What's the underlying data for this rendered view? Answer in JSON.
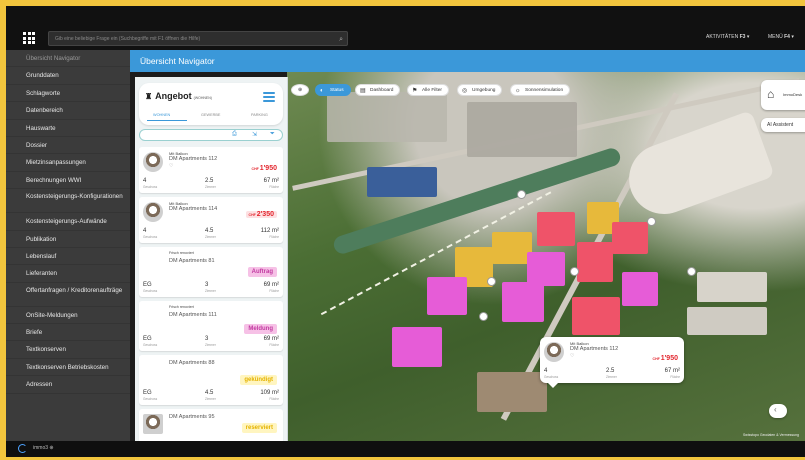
{
  "topbar": {
    "search_placeholder": "Gib eine beliebige Frage ein (Suchbegriffe mit F1 öffnen die Hilfe)",
    "activities_label": "AKTIVITÄTEN",
    "activities_count": "F3",
    "menu_label": "MENÜ",
    "menu_count": "F4"
  },
  "sidebar": {
    "items": [
      {
        "label": "Übersicht Navigator"
      },
      {
        "label": "Grunddaten"
      },
      {
        "label": "Schlagworte"
      },
      {
        "label": "Datenbereich"
      },
      {
        "label": "Hauswarte"
      },
      {
        "label": "Dossier"
      },
      {
        "label": "Mietzinsanpassungen"
      },
      {
        "label": "Berechnungen WWI"
      },
      {
        "label": "Kostensteigerungs-Konfigurationen"
      },
      {
        "label": "Kostensteigerungs-Aufwände"
      },
      {
        "label": "Publikation"
      },
      {
        "label": "Lebenslauf"
      },
      {
        "label": "Lieferanten"
      },
      {
        "label": "Offertanfragen / Kreditorenaufträge"
      },
      {
        "label": "OnSite-Meldungen"
      },
      {
        "label": "Briefe"
      },
      {
        "label": "Textkonserven"
      },
      {
        "label": "Textkonserven Betriebskosten"
      },
      {
        "label": "Adressen"
      }
    ]
  },
  "header": {
    "title": "Übersicht Navigator"
  },
  "panel": {
    "title": "Angebot",
    "subtitle": "(WOHNEN)",
    "tabs": [
      "WOHNEN",
      "GEWERBE",
      "PARKING"
    ],
    "cards": [
      {
        "top": "Mit Balkon",
        "title": "DM Apartments 112",
        "price": "1'950",
        "currency": "CHF",
        "floor": "4",
        "floor_label": "Geschoss",
        "rooms": "2.5",
        "rooms_label": "Zimmer",
        "area": "67 m²",
        "area_label": "Fläche"
      },
      {
        "top": "Mit Balkon",
        "title": "DM Apartments 114",
        "price": "2'350",
        "currency": "CHF",
        "floor": "4",
        "floor_label": "Geschoss",
        "rooms": "4.5",
        "rooms_label": "Zimmer",
        "area": "112 m²",
        "area_label": "Fläche"
      },
      {
        "top": "Frisch renoviert",
        "title": "DM Apartments 81",
        "badge": "Auftrag",
        "floor": "EG",
        "floor_label": "Geschoss",
        "rooms": "3",
        "rooms_label": "Zimmer",
        "area": "69 m²",
        "area_label": "Fläche"
      },
      {
        "top": "Frisch renoviert",
        "title": "DM Apartments 111",
        "badge": "Meldung",
        "floor": "EG",
        "floor_label": "Geschoss",
        "rooms": "3",
        "rooms_label": "Zimmer",
        "area": "69 m²",
        "area_label": "Fläche"
      },
      {
        "top": "",
        "title": "DM Apartments 88",
        "badge": "gekündigt",
        "floor": "EG",
        "floor_label": "Geschoss",
        "rooms": "4.5",
        "rooms_label": "Zimmer",
        "area": "109 m²",
        "area_label": "Fläche"
      },
      {
        "top": "",
        "title": "DM Apartments 95",
        "badge": "reserviert"
      }
    ]
  },
  "map_toolbar": [
    "Status",
    "Dashboard",
    "Alle Filter",
    "Umgebung",
    "Sonnensimulation"
  ],
  "popup": {
    "top": "Mit Balkon",
    "title": "DM Apartments 112",
    "price": "1'950",
    "currency": "CHF",
    "floor": "4",
    "floor_label": "Geschoss",
    "rooms": "2.5",
    "rooms_label": "Zimmer",
    "area": "67 m²",
    "area_label": "Fläche"
  },
  "map_right": {
    "brand": "ImmoDesk",
    "ai_label": "AI Assistent"
  },
  "map_attribution": "Swisstopo Geodaten & Vermessung",
  "bottombar": {
    "text": "immo3 ⊕"
  },
  "colors": {
    "header_blue": "#3b98d9",
    "price_red": "#e3262e",
    "frame_yellow": "#f2c53d",
    "sidebar_bg": "#3b3b3b"
  }
}
